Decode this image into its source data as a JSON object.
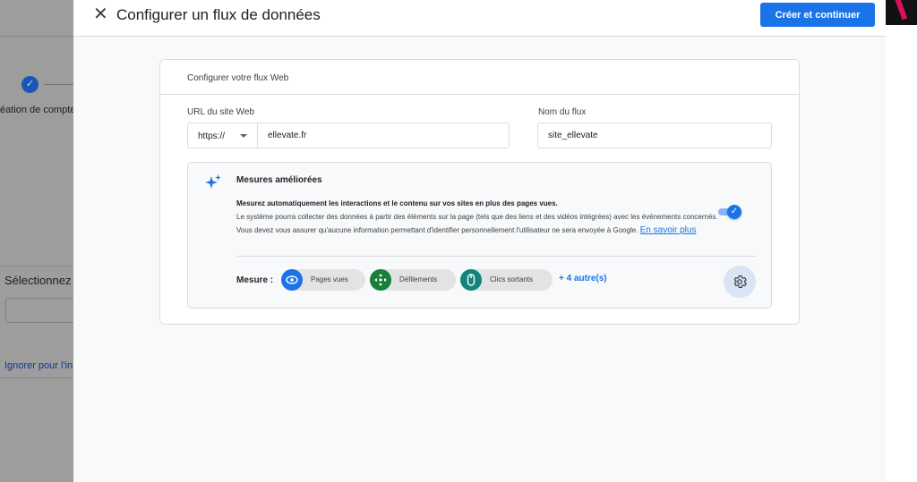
{
  "background": {
    "step_label": "éation de compte",
    "select_title": "Sélectionnez u",
    "ignore_link": "Ignorer pour l'in"
  },
  "panel": {
    "title": "Configurer un flux de données",
    "primary_button": "Créer et continuer"
  },
  "card": {
    "title": "Configurer votre flux Web",
    "url_label": "URL du site Web",
    "protocol_value": "https://",
    "url_value": "ellevate.fr",
    "stream_name_label": "Nom du flux",
    "stream_name_value": "site_ellevate"
  },
  "enhanced": {
    "title": "Mesures améliorées",
    "desc_bold": "Mesurez automatiquement les interactions et le contenu sur vos sites en plus des pages vues.",
    "desc_text": "Le système pourra collecter des données à partir des éléments sur la page (tels que des liens et des vidéos intégrées) avec les événements concernés. Vous devez vous assurer qu'aucune information permettant d'identifier personnellement l'utilisateur ne sera envoyée à Google.",
    "learn_more": "En savoir plus",
    "toggle_on": true,
    "measure_label": "Mesure :",
    "chips": [
      {
        "label": "Pages vues",
        "icon": "eye-icon",
        "color": "#1a73e8"
      },
      {
        "label": "Défilements",
        "icon": "scroll-icon",
        "color": "#188038"
      },
      {
        "label": "Clics sortants",
        "icon": "mouse-icon",
        "color": "#12857a"
      }
    ],
    "more": "+ 4 autre(s)"
  },
  "colors": {
    "accent": "#1a73e8"
  }
}
